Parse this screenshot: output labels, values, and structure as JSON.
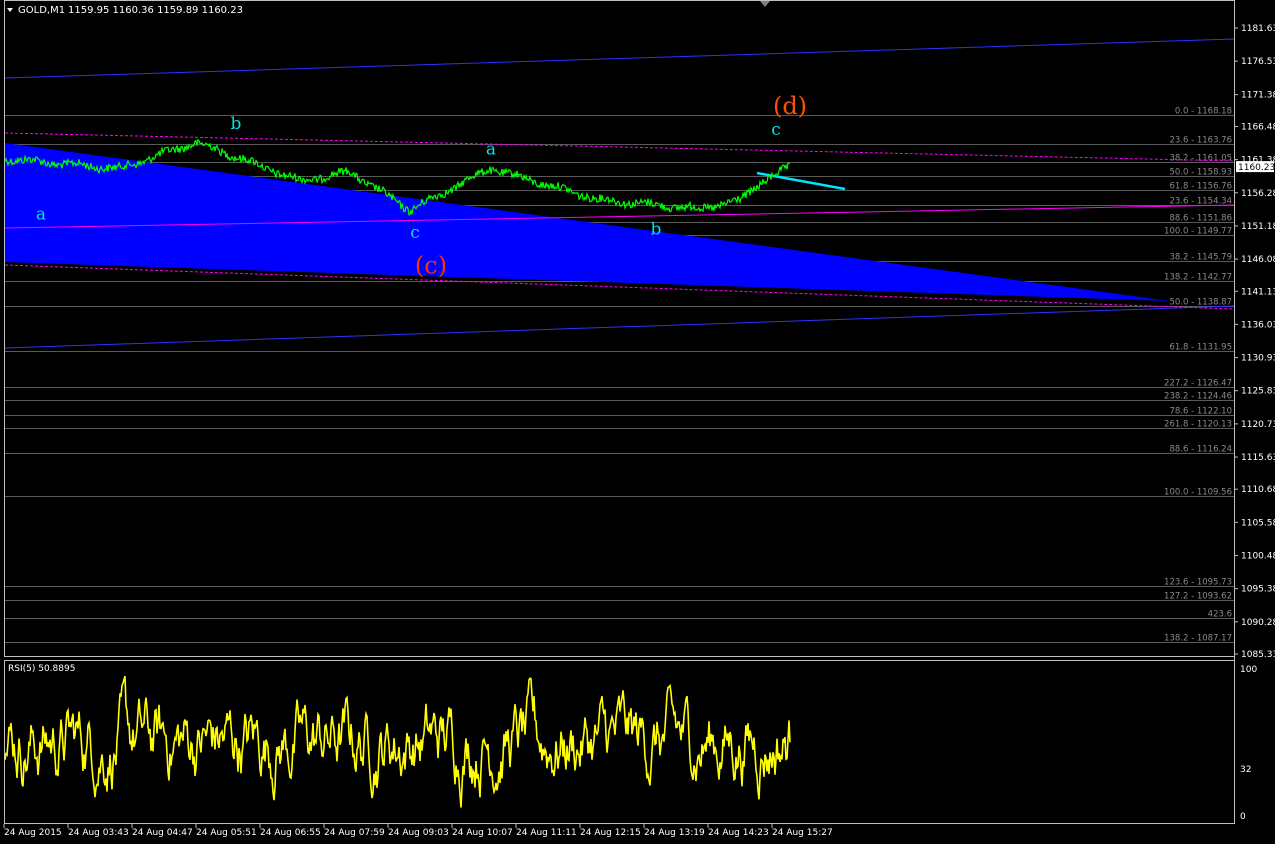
{
  "header": {
    "symbol_label": "GOLD,M1",
    "ohlc": "1159.95 1160.36 1159.89 1160.23"
  },
  "current_price": "1160.23",
  "price_axis": {
    "labels": [
      "1181.63",
      "1176.53",
      "1171.38",
      "1166.48",
      "1161.38",
      "1156.28",
      "1151.18",
      "1146.08",
      "1141.13",
      "1136.03",
      "1130.93",
      "1125.83",
      "1120.73",
      "1115.63",
      "1110.68",
      "1105.58",
      "1100.48",
      "1095.38",
      "1090.28",
      "1085.33"
    ]
  },
  "fib_labels": [
    {
      "text": "0.0 - 1168.18",
      "price": 1168.18
    },
    {
      "text": "23.6 - 1163.76",
      "price": 1163.76
    },
    {
      "text": "38.2 - 1161.05",
      "price": 1161.05
    },
    {
      "text": "50.0 - 1158.93",
      "price": 1158.93
    },
    {
      "text": "61.8 - 1156.76",
      "price": 1156.76
    },
    {
      "text": "23.6 - 1154.34",
      "price": 1154.34
    },
    {
      "text": "88.6 - 1151.86",
      "price": 1151.86
    },
    {
      "text": "100.0 - 1149.77",
      "price": 1149.77
    },
    {
      "text": "38.2 - 1145.79",
      "price": 1145.79
    },
    {
      "text": "138.2 - 1142.77",
      "price": 1142.77
    },
    {
      "text": "50.0 - 1138.87",
      "price": 1138.87
    },
    {
      "text": "61.8 - 1131.95",
      "price": 1131.95
    },
    {
      "text": "227.2 - 1126.47",
      "price": 1126.47
    },
    {
      "text": "238.2 - 1124.46",
      "price": 1124.46
    },
    {
      "text": "78.6 - 1122.10",
      "price": 1122.1
    },
    {
      "text": "261.8 - 1120.13",
      "price": 1120.13
    },
    {
      "text": "88.6 - 1116.24",
      "price": 1116.24
    },
    {
      "text": "100.0 - 1109.56",
      "price": 1109.56
    },
    {
      "text": "123.6 - 1095.73",
      "price": 1095.73
    },
    {
      "text": "127.2 - 1093.62",
      "price": 1093.62
    },
    {
      "text": "423.6",
      "price": 1090.9
    },
    {
      "text": "138.2 - 1087.17",
      "price": 1087.17
    }
  ],
  "wave_labels": [
    {
      "text": "a",
      "price": 1152.2,
      "color": "#00e5e5"
    },
    {
      "text": "b",
      "price": 1166.1,
      "color": "#00e5e5"
    },
    {
      "text": "c",
      "price": 1149.3,
      "color": "#00e5e5"
    },
    {
      "text": "(c)",
      "price": 1143.9,
      "color": "#ff3000"
    },
    {
      "text": "a",
      "price": 1162.2,
      "color": "#00e5e5"
    },
    {
      "text": "b",
      "price": 1149.9,
      "color": "#00e5e5"
    },
    {
      "text": "c",
      "price": 1165.2,
      "color": "#00e5e5"
    },
    {
      "text": "(d)",
      "price": 1168.4,
      "color": "#ff5000"
    }
  ],
  "time_axis": {
    "labels": [
      "24 Aug 2015",
      "24 Aug 03:43",
      "24 Aug 04:47",
      "24 Aug 05:51",
      "24 Aug 06:55",
      "24 Aug 07:59",
      "24 Aug 09:03",
      "24 Aug 10:07",
      "24 Aug 11:11",
      "24 Aug 12:15",
      "24 Aug 13:19",
      "24 Aug 14:23",
      "24 Aug 15:27"
    ]
  },
  "rsi": {
    "label": "RSI(5) 50.8895",
    "levels": [
      "100",
      "32",
      "0"
    ]
  },
  "colors": {
    "price_line": "#00ff00",
    "rsi_line": "#ffff00",
    "triangle": "#0000ff",
    "channel": "#3030ff",
    "magenta": "#ff00ff",
    "fib": "#8a8a8a",
    "trend_cyan": "#00e5ff",
    "price_tag_bg": "#ffffff"
  },
  "chart_data": {
    "type": "line",
    "price_series": {
      "name": "GOLD,M1",
      "x": [
        "24 Aug 2015",
        "24 Aug 03:43",
        "24 Aug 04:47",
        "24 Aug 05:51",
        "24 Aug 06:55",
        "24 Aug 07:59",
        "24 Aug 09:03",
        "24 Aug 10:07",
        "24 Aug 11:11",
        "24 Aug 12:15",
        "24 Aug 13:19",
        "24 Aug 14:23",
        "24 Aug 15:27"
      ],
      "y": [
        1161.5,
        1160.0,
        1164.0,
        1162.2,
        1158.1,
        1159.5,
        1153.6,
        1160.0,
        1155.2,
        1153.8,
        1155.1,
        1157.8,
        1160.23
      ]
    },
    "ylim": [
      1083.0,
      1185.0
    ],
    "rsi_ylim": [
      0,
      100
    ],
    "grid": false
  }
}
